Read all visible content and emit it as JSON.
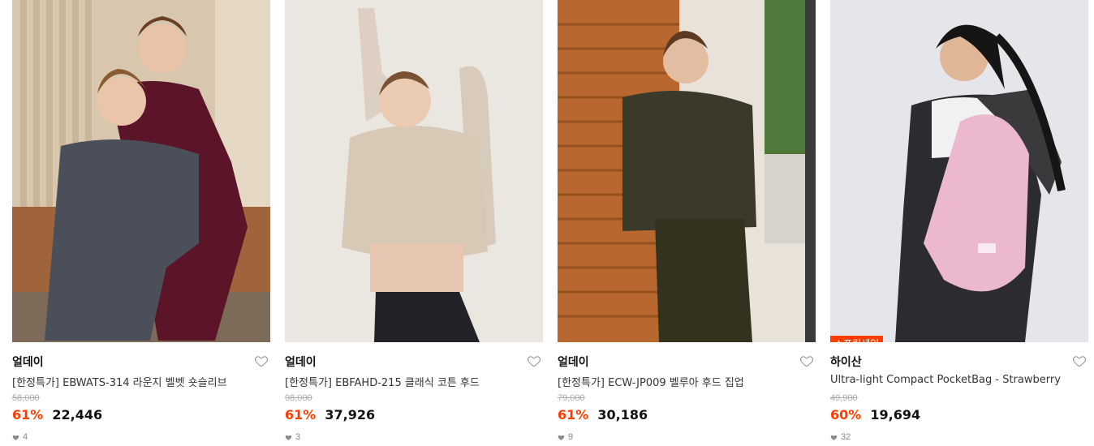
{
  "products": [
    {
      "brand": "얼데이",
      "name": "[한정특가] EBWATS-314 라운지 벨벳 숏슬리브",
      "original_price": "58,000",
      "discount_rate": "61%",
      "price": "22,446",
      "likes": "4",
      "badge": "",
      "image_icon": "photo-two-models-velvet-loungewear"
    },
    {
      "brand": "얼데이",
      "name": "[한정특가] EBFAHD-215 클래식 코튼 후드",
      "original_price": "98,000",
      "discount_rate": "61%",
      "price": "37,926",
      "likes": "3",
      "badge": "",
      "image_icon": "photo-model-beige-hoodie"
    },
    {
      "brand": "얼데이",
      "name": "[한정특가] ECW-JP009 벨루아 후드 집업",
      "original_price": "79,000",
      "discount_rate": "61%",
      "price": "30,186",
      "likes": "9",
      "badge": "",
      "image_icon": "photo-model-khaki-velour-set"
    },
    {
      "brand": "하이산",
      "name": "Ultra-light Compact PocketBag - Strawberry",
      "original_price": "49,900",
      "discount_rate": "60%",
      "price": "19,694",
      "likes": "32",
      "badge": "스프링세일",
      "image_icon": "photo-model-pink-sling-bag"
    }
  ],
  "colors": {
    "accent": "#ff3d00",
    "muted": "#888888"
  }
}
